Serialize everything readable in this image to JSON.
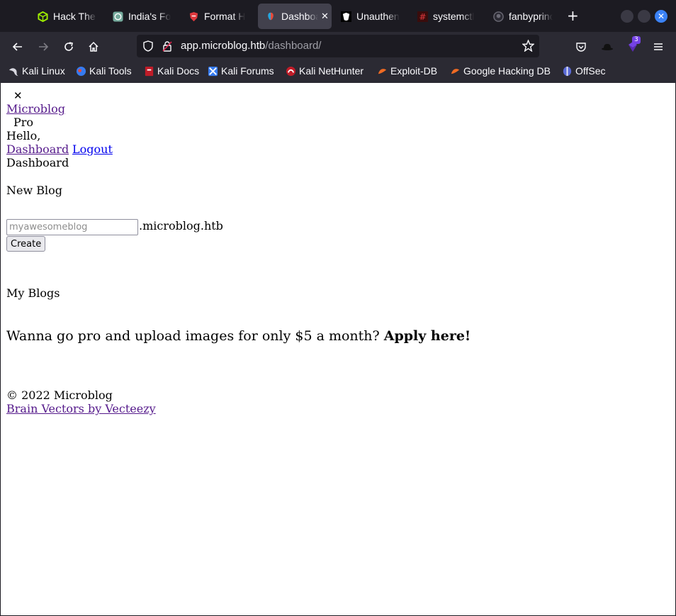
{
  "browser": {
    "tabs": [
      {
        "label": "Hack The Box",
        "icon": "hackthebox-icon",
        "color": "#9fef00"
      },
      {
        "label": "India's Fo",
        "icon": "chatgpt-icon",
        "color": "#74aa9c"
      },
      {
        "label": "Format H",
        "icon": "shield-icon",
        "color": "#e0393e"
      },
      {
        "label": "Dashboard",
        "icon": "microblog-icon",
        "color": "#2aa3d9"
      },
      {
        "label": "Unauthen",
        "icon": "hacktricks-icon",
        "color": "#ffffff"
      },
      {
        "label": "systemctl",
        "icon": "hash-icon",
        "color": "#e0393e"
      },
      {
        "label": "fanbyprinc",
        "icon": "github-icon",
        "color": "#9e9ea6"
      }
    ],
    "new_tab_label": "+",
    "url_host": "app.microblog.htb",
    "url_path": "/dashboard/",
    "extension_badge": "3",
    "bookmarks": [
      {
        "label": "Kali Linux",
        "icon": "kali-dragon-icon"
      },
      {
        "label": "Kali Tools",
        "icon": "kali-tools-icon"
      },
      {
        "label": "Kali Docs",
        "icon": "kali-docs-icon"
      },
      {
        "label": "Kali Forums",
        "icon": "kali-forums-icon"
      },
      {
        "label": "Kali NetHunter",
        "icon": "nethunter-icon"
      },
      {
        "label": "Exploit-DB",
        "icon": "exploitdb-icon"
      },
      {
        "label": "Google Hacking DB",
        "icon": "ghdb-icon"
      },
      {
        "label": "OffSec",
        "icon": "offsec-icon"
      }
    ]
  },
  "page": {
    "close_glyph": "✕",
    "brand": "Microblog",
    "pro_label": "Pro",
    "greeting": "Hello,",
    "nav_dashboard": "Dashboard",
    "nav_logout": "Logout",
    "heading": "Dashboard",
    "new_blog_label": "New Blog",
    "subdomain_placeholder": "myawesomeblog",
    "domain_suffix": ".microblog.htb",
    "create_button": "Create",
    "my_blogs_label": "My Blogs",
    "pro_pitch": "Wanna go pro and upload images for only $5 a month?",
    "apply_link": "Apply here!",
    "copyright": "© 2022 Microblog",
    "credit_link": "Brain Vectors by Vecteezy"
  }
}
